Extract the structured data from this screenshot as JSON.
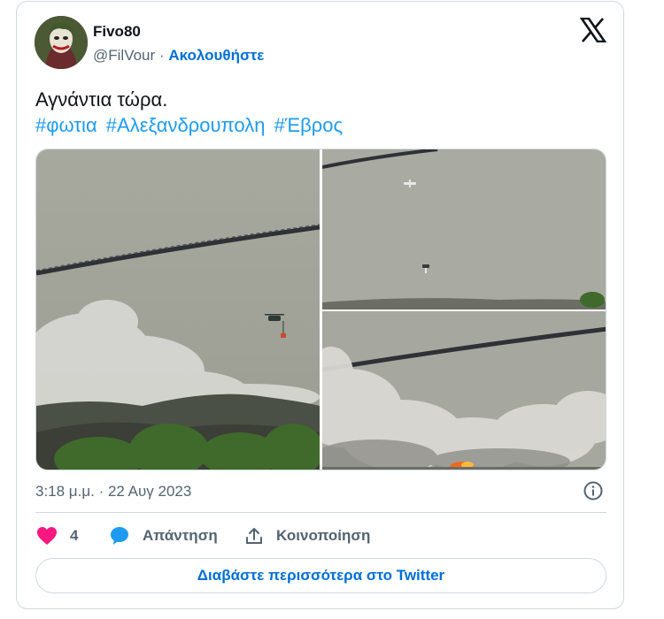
{
  "tweet": {
    "author_name": "Fivo80",
    "handle": "@FilVour",
    "separator": "·",
    "follow_label": "Ακολουθήστε",
    "text": "Αγνάντια τώρα.",
    "hashtags": [
      "#φωτια",
      "#Αλεξανδρουπολη",
      "#Έβρος"
    ],
    "timestamp": "3:18 μ.μ. · 22 Αυγ 2023",
    "likes_count": "4",
    "reply_label": "Απάντηση",
    "share_label": "Κοινοποίηση",
    "read_more_label": "Διαβάστε περισσότερα στο Twitter"
  },
  "icons": {
    "brand": "x-logo-icon",
    "info": "info-icon",
    "like": "heart-icon",
    "reply": "speech-bubble-icon",
    "share": "share-upload-icon"
  },
  "colors": {
    "like": "#f91880",
    "reply": "#1d9bf0",
    "link": "#006fd6",
    "hashtag": "#1d9bf0",
    "muted": "#536471",
    "border": "#cfd9de"
  }
}
